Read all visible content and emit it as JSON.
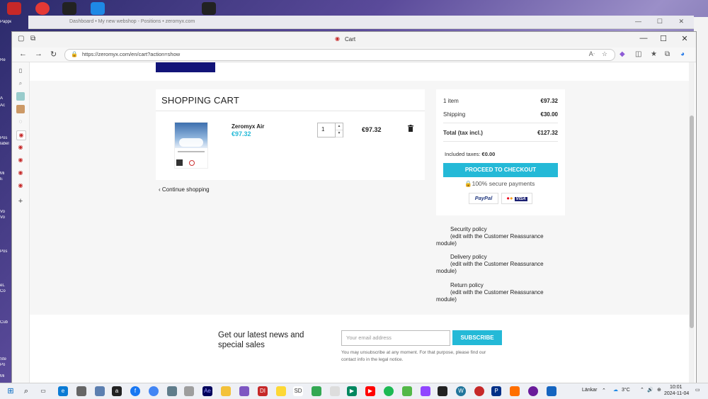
{
  "desktop": {
    "left_labels": [
      "Papperskorg",
      "Re",
      "A",
      "Ac",
      "Pos",
      "label",
      "Mi",
      "E",
      "Vo",
      "Vo",
      "Pos",
      "eL",
      "Co",
      "Cub",
      "Ste",
      "Po",
      "Mi"
    ]
  },
  "background_window": {
    "title": "Dashboard • My new webshop - Positions • zeromyx.com"
  },
  "browser": {
    "tab_title": "Cart",
    "url": "https://zeromyx.com/en/cart?action=show",
    "controls": {
      "minimize": "—",
      "maximize": "☐",
      "close": "✕"
    }
  },
  "cart": {
    "title": "SHOPPING CART",
    "items": [
      {
        "name": "Zeromyx Air",
        "unit_price": "€97.32",
        "quantity": "1",
        "total": "€97.32"
      }
    ],
    "continue_label": "Continue shopping"
  },
  "summary": {
    "items_label": "1 item",
    "items_value": "€97.32",
    "shipping_label": "Shipping",
    "shipping_value": "€30.00",
    "total_label": "Total (tax incl.)",
    "total_value": "€127.32",
    "taxes_label": "Included taxes:",
    "taxes_value": "€0.00",
    "checkout_label": "PROCEED TO CHECKOUT",
    "secure_label": "100% secure payments",
    "paypal_label": "PayPal",
    "visa_label": "VISA"
  },
  "reassurance": [
    {
      "title": "Security policy",
      "note": "(edit with the Customer Reassurance",
      "tail": "module)"
    },
    {
      "title": "Delivery policy",
      "note": "(edit with the Customer Reassurance",
      "tail": "module)"
    },
    {
      "title": "Return policy",
      "note": "(edit with the Customer Reassurance",
      "tail": "module)"
    }
  ],
  "newsletter": {
    "title": "Get our latest news and special sales",
    "email_placeholder": "Your email address",
    "subscribe_label": "SUBSCRIBE",
    "note": "You may unsubscribe at any moment. For that purpose, please find our contact info in the legal notice."
  },
  "taskbar": {
    "links_label": "Länkar",
    "weather": "3°C",
    "time": "10:01",
    "date": "2024-11-04"
  },
  "colors": {
    "accent": "#24b9d7",
    "logo": "#121478"
  }
}
